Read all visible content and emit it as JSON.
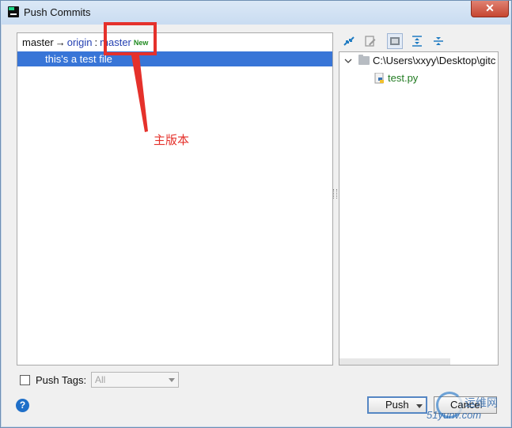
{
  "window": {
    "title": "Push Commits",
    "close_label": "✕"
  },
  "commits": {
    "branch": {
      "local": "master",
      "arrow": "→",
      "remote": "origin",
      "separator": ":",
      "remote_branch": "master",
      "new_badge": "New"
    },
    "items": [
      {
        "label": "this's a test file",
        "selected": true
      }
    ]
  },
  "annotation": {
    "text": "主版本",
    "color": "#e5312b"
  },
  "toolbar": {
    "icons": [
      "expand-icon",
      "edit-source-icon",
      "group-by-directory-icon",
      "expand-all-icon",
      "collapse-all-icon"
    ],
    "toggled": "group-by-directory-icon"
  },
  "files": {
    "root_path": "C:\\Users\\xxyy\\Desktop\\gitc",
    "items": [
      {
        "name": "test.py",
        "icon": "python-file-icon"
      }
    ]
  },
  "push_tags": {
    "label": "Push Tags:",
    "checked": false,
    "select_value": "All"
  },
  "buttons": {
    "help": "?",
    "push": "Push",
    "cancel": "Cancel"
  },
  "watermark": {
    "cn": "运维网",
    "en": "51yunv.com"
  },
  "colors": {
    "selection": "#3875d7",
    "remote_branch": "#2541b2",
    "new_badge": "#1f8a1f",
    "file_name": "#207a20",
    "highlight": "#e5312b"
  }
}
